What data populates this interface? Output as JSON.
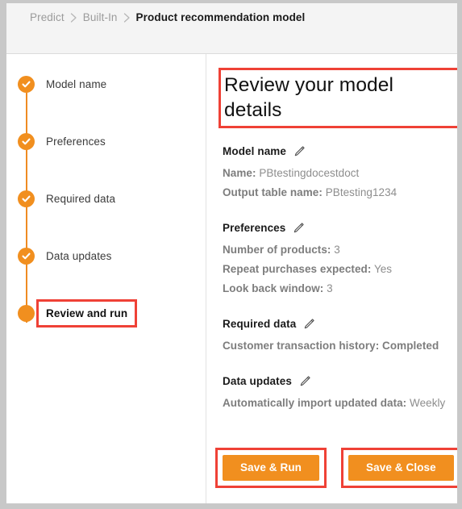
{
  "breadcrumb": {
    "items": [
      {
        "label": "Predict",
        "current": false
      },
      {
        "label": "Built-In",
        "current": false
      },
      {
        "label": "Product recommendation model",
        "current": true
      }
    ],
    "separator_icon": "chevron-right-icon"
  },
  "sidebar": {
    "steps": [
      {
        "label": "Model name",
        "state": "completed",
        "icon": "check-circle-icon"
      },
      {
        "label": "Preferences",
        "state": "completed",
        "icon": "check-circle-icon"
      },
      {
        "label": "Required data",
        "state": "completed",
        "icon": "check-circle-icon"
      },
      {
        "label": "Data updates",
        "state": "completed",
        "icon": "check-circle-icon"
      },
      {
        "label": "Review and run",
        "state": "active",
        "icon": "filled-circle-icon"
      }
    ]
  },
  "main": {
    "title": "Review your model details",
    "sections": [
      {
        "title": "Model name",
        "edit_icon": "pencil-icon",
        "rows": [
          {
            "label": "Name:",
            "value": "PBtestingdocestdoct",
            "bold_value": false
          },
          {
            "label": "Output table name:",
            "value": "PBtesting1234",
            "bold_value": false
          }
        ]
      },
      {
        "title": "Preferences",
        "edit_icon": "pencil-icon",
        "rows": [
          {
            "label": "Number of products:",
            "value": "3",
            "bold_value": false
          },
          {
            "label": "Repeat purchases expected:",
            "value": "Yes",
            "bold_value": false
          },
          {
            "label": "Look back window:",
            "value": "3",
            "bold_value": false
          }
        ]
      },
      {
        "title": "Required data",
        "edit_icon": "pencil-icon",
        "rows": [
          {
            "label": "Customer transaction history:",
            "value": "Completed",
            "bold_value": true
          }
        ]
      },
      {
        "title": "Data updates",
        "edit_icon": "pencil-icon",
        "rows": [
          {
            "label": "Automatically import updated data:",
            "value": "Weekly",
            "bold_value": false
          }
        ]
      }
    ],
    "actions": {
      "save_run_label": "Save & Run",
      "save_close_label": "Save & Close"
    }
  },
  "colors": {
    "accent_orange": "#f18f1f",
    "annotation_red": "#ef4136",
    "header_bg": "#f4f4f4",
    "text_dark": "#1a1a1a",
    "text_muted": "#8d8d8d"
  }
}
